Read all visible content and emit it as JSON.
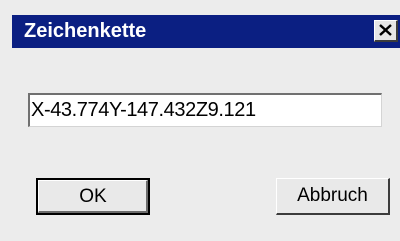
{
  "dialog": {
    "title": "Zeichenkette",
    "close_glyph": "close-icon",
    "text_value": "X-43.774Y-147.432Z9.121",
    "ok_label": "OK",
    "cancel_label": "Abbruch"
  },
  "colors": {
    "titlebar": "#0b1f82",
    "dialog_background": "#ececec",
    "field_background": "#ffffff"
  }
}
